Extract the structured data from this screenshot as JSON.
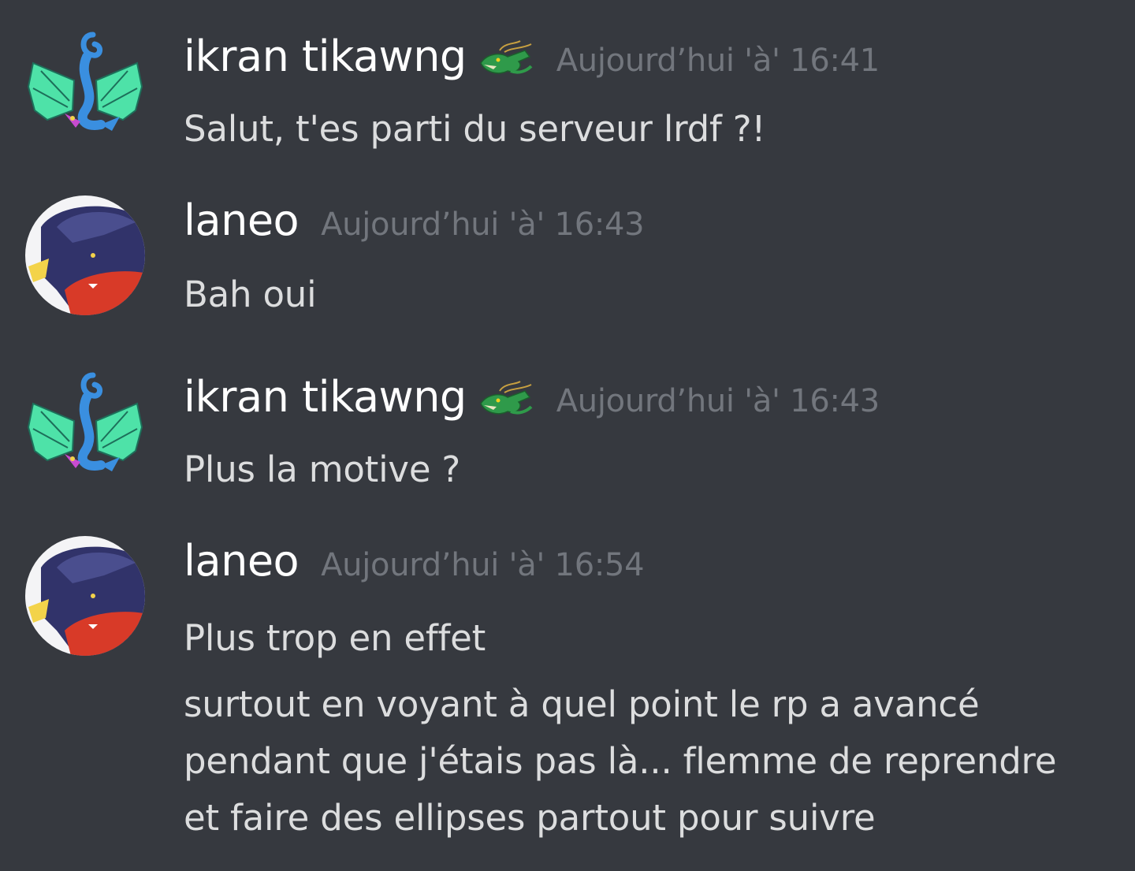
{
  "colors": {
    "background": "#36393f",
    "username": "#ffffff",
    "timestamp": "#72767d",
    "message_text": "#dcddde"
  },
  "messages": [
    {
      "author": "ikran tikawng",
      "role_icon": "dragon-icon",
      "timestamp": "Aujourd’hui 'à' 16:41",
      "lines": [
        "Salut, t'es parti du serveur lrdf ?!"
      ]
    },
    {
      "author": "laneo",
      "timestamp": "Aujourd’hui 'à' 16:43",
      "lines": [
        "Bah oui"
      ]
    },
    {
      "author": "ikran tikawng",
      "role_icon": "dragon-icon",
      "timestamp": "Aujourd’hui 'à' 16:43",
      "lines": [
        "Plus la motive ?"
      ]
    },
    {
      "author": "laneo",
      "timestamp": "Aujourd’hui 'à' 16:54",
      "lines": [
        "Plus trop en effet",
        "surtout en voyant à quel point le rp a avancé",
        "pendant que j'étais pas là... flemme de reprendre",
        "et faire des ellipses partout pour suivre"
      ]
    }
  ]
}
